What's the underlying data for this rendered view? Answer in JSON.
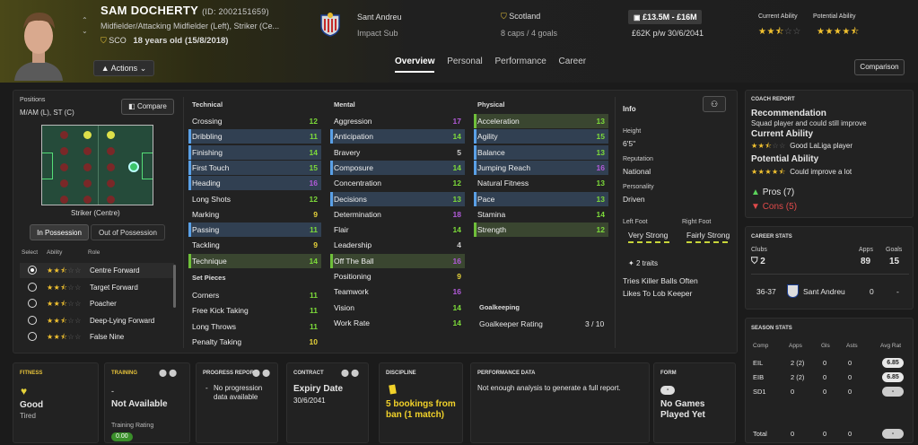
{
  "player": {
    "name": "SAM DOCHERTY",
    "id": "(ID: 2002151659)",
    "positions": "Midfielder/Attacking Midfielder (Left), Striker (Ce...",
    "nation": "SCO",
    "age": "18 years old (15/8/2018)",
    "actions": "Actions"
  },
  "club": {
    "name": "Sant Andreu",
    "role": "Impact Sub"
  },
  "intl": {
    "country": "Scotland",
    "caps": "8 caps / 4 goals"
  },
  "value": {
    "range": "£13.5M - £16M",
    "wage": "£62K p/w 30/6/2041"
  },
  "ability": {
    "ca_label": "Current Ability",
    "pa_label": "Potential Ability",
    "ca": 2.5,
    "pa": 4.5
  },
  "tabs": [
    "Overview",
    "Personal",
    "Performance",
    "Career"
  ],
  "comparison": "Comparison",
  "positions_panel": {
    "label": "Positions",
    "value": "M/AM (L), ST (C)",
    "compare": "Compare",
    "current": "Striker (Centre)",
    "in_possession": "In Possession",
    "out_possession": "Out of Possession",
    "cols": [
      "Select",
      "Ability",
      "Role"
    ],
    "roles": [
      {
        "name": "Centre Forward",
        "stars": 2.5,
        "selected": true
      },
      {
        "name": "Target Forward",
        "stars": 2.5,
        "selected": false
      },
      {
        "name": "Poacher",
        "stars": 2.5,
        "selected": false
      },
      {
        "name": "Deep-Lying Forward",
        "stars": 2.5,
        "selected": false
      },
      {
        "name": "False Nine",
        "stars": 2.5,
        "selected": false
      }
    ]
  },
  "technical": {
    "title": "Technical",
    "items": [
      {
        "n": "Crossing",
        "v": "12",
        "c": "g",
        "h": ""
      },
      {
        "n": "Dribbling",
        "v": "11",
        "c": "g",
        "h": "hlb"
      },
      {
        "n": "Finishing",
        "v": "14",
        "c": "g",
        "h": "hlb"
      },
      {
        "n": "First Touch",
        "v": "15",
        "c": "g",
        "h": "hlb"
      },
      {
        "n": "Heading",
        "v": "16",
        "c": "p",
        "h": "hlb"
      },
      {
        "n": "Long Shots",
        "v": "12",
        "c": "g",
        "h": ""
      },
      {
        "n": "Marking",
        "v": "9",
        "c": "y",
        "h": ""
      },
      {
        "n": "Passing",
        "v": "11",
        "c": "g",
        "h": "hlb"
      },
      {
        "n": "Tackling",
        "v": "9",
        "c": "y",
        "h": ""
      },
      {
        "n": "Technique",
        "v": "14",
        "c": "g",
        "h": "hlg"
      }
    ]
  },
  "setpieces": {
    "title": "Set Pieces",
    "items": [
      {
        "n": "Corners",
        "v": "11",
        "c": "g"
      },
      {
        "n": "Free Kick Taking",
        "v": "11",
        "c": "g"
      },
      {
        "n": "Long Throws",
        "v": "11",
        "c": "g"
      },
      {
        "n": "Penalty Taking",
        "v": "10",
        "c": "y"
      }
    ]
  },
  "mental": {
    "title": "Mental",
    "items": [
      {
        "n": "Aggression",
        "v": "17",
        "c": "p",
        "h": ""
      },
      {
        "n": "Anticipation",
        "v": "14",
        "c": "g",
        "h": "hlb"
      },
      {
        "n": "Bravery",
        "v": "5",
        "c": "w",
        "h": ""
      },
      {
        "n": "Composure",
        "v": "14",
        "c": "g",
        "h": "hlb"
      },
      {
        "n": "Concentration",
        "v": "12",
        "c": "g",
        "h": ""
      },
      {
        "n": "Decisions",
        "v": "13",
        "c": "g",
        "h": "hlb"
      },
      {
        "n": "Determination",
        "v": "18",
        "c": "p",
        "h": ""
      },
      {
        "n": "Flair",
        "v": "14",
        "c": "g",
        "h": ""
      },
      {
        "n": "Leadership",
        "v": "4",
        "c": "w",
        "h": ""
      },
      {
        "n": "Off The Ball",
        "v": "16",
        "c": "p",
        "h": "hlg"
      },
      {
        "n": "Positioning",
        "v": "9",
        "c": "y",
        "h": ""
      },
      {
        "n": "Teamwork",
        "v": "16",
        "c": "p",
        "h": ""
      },
      {
        "n": "Vision",
        "v": "14",
        "c": "g",
        "h": ""
      },
      {
        "n": "Work Rate",
        "v": "14",
        "c": "g",
        "h": ""
      }
    ]
  },
  "physical": {
    "title": "Physical",
    "items": [
      {
        "n": "Acceleration",
        "v": "13",
        "c": "g",
        "h": "hlg"
      },
      {
        "n": "Agility",
        "v": "15",
        "c": "g",
        "h": "hlb"
      },
      {
        "n": "Balance",
        "v": "13",
        "c": "g",
        "h": "hlb"
      },
      {
        "n": "Jumping Reach",
        "v": "16",
        "c": "p",
        "h": "hlb"
      },
      {
        "n": "Natural Fitness",
        "v": "13",
        "c": "g",
        "h": ""
      },
      {
        "n": "Pace",
        "v": "13",
        "c": "g",
        "h": "hlb"
      },
      {
        "n": "Stamina",
        "v": "14",
        "c": "g",
        "h": ""
      },
      {
        "n": "Strength",
        "v": "12",
        "c": "g",
        "h": "hlg"
      }
    ]
  },
  "goalkeeping": {
    "title": "Goalkeeping",
    "label": "Goalkeeper Rating",
    "value": "3 / 10"
  },
  "info": {
    "title": "Info",
    "height_l": "Height",
    "height": "6'5\"",
    "rep_l": "Reputation",
    "rep": "National",
    "pers_l": "Personality",
    "pers": "Driven",
    "lf_l": "Left Foot",
    "lf": "Very Strong",
    "rf_l": "Right Foot",
    "rf": "Fairly Strong",
    "traits_count": "2 traits",
    "traits": [
      "Tries Killer Balls Often",
      "Likes To Lob Keeper"
    ]
  },
  "coach": {
    "title": "COACH REPORT",
    "rec_t": "Recommendation",
    "rec": "Squad player and could still improve",
    "ca_t": "Current Ability",
    "ca_txt": "Good LaLiga player",
    "pa_t": "Potential Ability",
    "pa_txt": "Could improve a lot",
    "pros": "Pros (7)",
    "cons": "Cons (5)"
  },
  "career": {
    "title": "CAREER STATS",
    "clubs_l": "Clubs",
    "apps_l": "Apps",
    "goals_l": "Goals",
    "clubs": "2",
    "apps": "89",
    "goals": "15",
    "row": {
      "age": "36-37",
      "club": "Sant Andreu",
      "apps": "0",
      "goals": "-"
    }
  },
  "season": {
    "title": "SEASON STATS",
    "cols": [
      "Comp",
      "Apps",
      "Gls",
      "Asts",
      "Avg Rat"
    ],
    "rows": [
      {
        "comp": "EIL",
        "apps": "2 (2)",
        "gls": "0",
        "asts": "0",
        "rat": "6.85"
      },
      {
        "comp": "EIB",
        "apps": "2 (2)",
        "gls": "0",
        "asts": "0",
        "rat": "6.85"
      },
      {
        "comp": "SD1",
        "apps": "0",
        "gls": "0",
        "asts": "0",
        "rat": "-"
      }
    ],
    "total": {
      "comp": "Total",
      "apps": "0",
      "gls": "0",
      "asts": "0",
      "rat": "-"
    }
  },
  "bottom": {
    "fitness_t": "FITNESS",
    "fitness": "Good",
    "fitness_sub": "Tired",
    "training_t": "TRAINING",
    "training_dash": "-",
    "training": "Not Available",
    "training_rating_l": "Training Rating",
    "training_rating": "0.00",
    "progress_t": "PROGRESS REPORT",
    "progress": "No progression data available",
    "contract_t": "CONTRACT",
    "contract": "Expiry Date",
    "contract_date": "30/6/2041",
    "discipline_t": "DISCIPLINE",
    "discipline": "5 bookings from ban (1 match)",
    "perf_t": "PERFORMANCE DATA",
    "perf": "Not enough analysis to generate a full report.",
    "form_t": "FORM",
    "form_pill": "-",
    "form": "No Games Played Yet"
  },
  "colors": {
    "green": "#7ddb3a",
    "yellow": "#e6d23a",
    "purple": "#b25bd9",
    "blue_hl": "#5aa0e6"
  }
}
